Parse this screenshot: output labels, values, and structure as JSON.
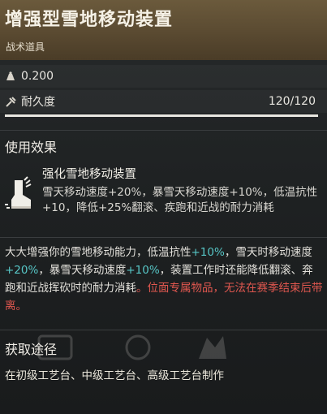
{
  "item": {
    "name": "增强型雪地移动装置",
    "category": "战术道具",
    "weight": "0.200",
    "durability_label": "耐久度",
    "durability_value": "120/120",
    "durability_fraction": 1.0
  },
  "effects_section": {
    "title": "使用效果",
    "effect_name": "强化雪地移动装置",
    "effect_description": "雪天移动速度+20%，暴雪天移动速度+10%，低温抗性+10，降低+25%翻滚、疾跑和近战的耐力消耗"
  },
  "description": {
    "seg1": "大大增强你的雪地移动能力，低温抗性",
    "seg2": "+10%",
    "seg3": "，雪天时移动速度",
    "seg4": "+20%",
    "seg5": "，暴雪天移动速度",
    "seg6": "+10%",
    "seg7": "，装置工作时还能降低翻滚、奔跑和近战挥砍时的耐力消耗",
    "seg8": "。位面专属物品，无法在赛季结束后带离。"
  },
  "obtain_section": {
    "title": "获取途径",
    "text": "在初级工艺台、中级工艺台、高级工艺台制作"
  },
  "colors": {
    "header": "#5a4a31",
    "highlight": "#57c7c7",
    "warning": "#e0574f"
  },
  "icons": {
    "weight": "weight-icon",
    "durability": "durability-icon",
    "effect": "snow-boot-icon"
  }
}
